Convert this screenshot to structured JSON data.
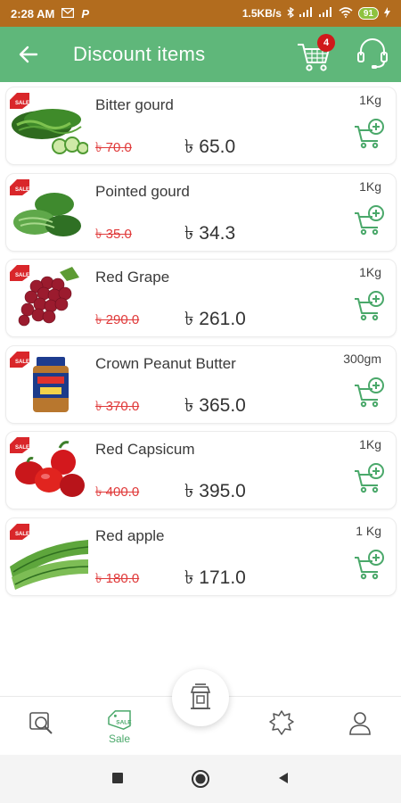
{
  "status_bar": {
    "time": "2:28 AM",
    "network_speed": "1.5KB/s",
    "battery": "91",
    "icons": [
      "gmail-icon",
      "p-icon",
      "bluetooth-icon",
      "signal-icon",
      "signal-icon",
      "wifi-icon",
      "battery-icon",
      "charging-icon"
    ]
  },
  "header": {
    "title": "Discount items",
    "cart_count": "4",
    "colors": {
      "bar": "#5fb77a",
      "badge": "#d0191b"
    }
  },
  "products": [
    {
      "name": "Bitter gourd",
      "old_price": "৳ 70.0",
      "new_price": "৳ 65.0",
      "unit": "1Kg",
      "image": "bitter-gourd"
    },
    {
      "name": "Pointed gourd",
      "old_price": "৳ 35.0",
      "new_price": "৳ 34.3",
      "unit": "1Kg",
      "image": "pointed-gourd"
    },
    {
      "name": "Red Grape",
      "old_price": "৳ 290.0",
      "new_price": "৳ 261.0",
      "unit": "1Kg",
      "image": "red-grape"
    },
    {
      "name": "Crown Peanut Butter",
      "old_price": "৳ 370.0",
      "new_price": "৳ 365.0",
      "unit": "300gm",
      "image": "peanut-butter"
    },
    {
      "name": "Red Capsicum",
      "old_price": "৳ 400.0",
      "new_price": "৳ 395.0",
      "unit": "1Kg",
      "image": "red-capsicum"
    },
    {
      "name": "Red apple",
      "old_price": "৳ 180.0",
      "new_price": "৳ 171.0",
      "unit": "1 Kg",
      "image": "ridge-gourd"
    }
  ],
  "bottom_nav": {
    "sale_label": "Sale",
    "items": [
      "search-icon",
      "sale-tag-icon",
      "store-icon",
      "badge-icon",
      "profile-icon"
    ]
  },
  "colors": {
    "accent": "#4aa86a",
    "strike": "#e03b3b"
  }
}
